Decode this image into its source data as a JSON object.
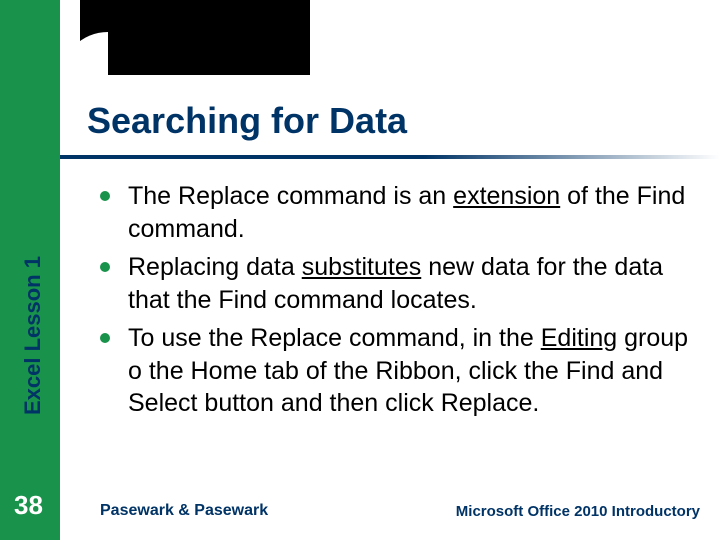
{
  "title": "Searching for Data",
  "side_label": "Excel Lesson 1",
  "page_number": "38",
  "bullets": [
    {
      "pre": "The Replace command is an ",
      "u1": "extension",
      "mid": " of the Find command.",
      "u2": "",
      "post": ""
    },
    {
      "pre": "Replacing data ",
      "u1": "substitutes",
      "mid": " new data for the data that the Find command locates.",
      "u2": "",
      "post": ""
    },
    {
      "pre": "To use the Replace command, in the ",
      "u1": "Editing",
      "mid": " group o the Home tab of the Ribbon, click the Find and Select button and then click Replace.",
      "u2": "",
      "post": ""
    }
  ],
  "footer": {
    "left": "Pasewark & Pasewark",
    "right": "Microsoft Office 2010 Introductory"
  }
}
